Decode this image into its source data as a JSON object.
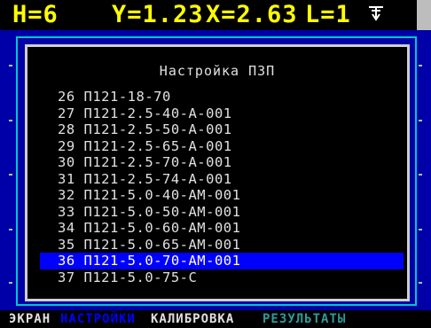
{
  "status": {
    "h": "H=6",
    "y": "Y=1.23",
    "x": "X=2.63",
    "l": "L=1",
    "icon": "grounding-arrow-icon"
  },
  "dialog": {
    "title": "Настройка ПЗП",
    "items": [
      "26 П121-18-70",
      "27 П121-2.5-40-А-001",
      "28 П121-2.5-50-А-001",
      "29 П121-2.5-65-А-001",
      "30 П121-2.5-70-А-001",
      "31 П121-2.5-74-А-001",
      "32 П121-5.0-40-АМ-001",
      "33 П121-5.0-50-АМ-001",
      "34 П121-5.0-60-АМ-001",
      "35 П121-5.0-65-АМ-001",
      "36 П121-5.0-70-АМ-001",
      "37 П121-5.0-75-С"
    ],
    "selected_index": 10
  },
  "menu": {
    "screen": "ЭКРАН",
    "settings": "НАСТРОЙКИ",
    "calibration": "КАЛИБРОВКА",
    "results": "РЕЗУЛЬТАТЫ"
  },
  "colors": {
    "status_text": "#ffff00",
    "background_blue": "#0000a8",
    "frame_cyan": "#00c8c8",
    "selection": "#0000ff"
  }
}
